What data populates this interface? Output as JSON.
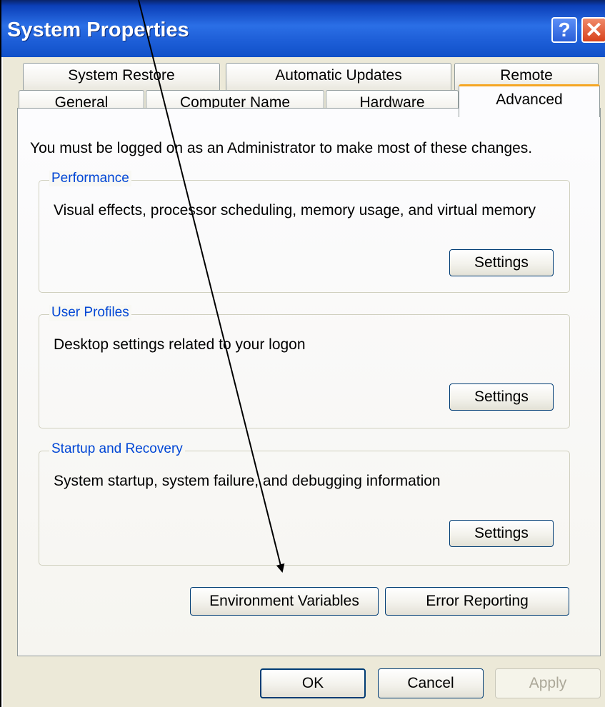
{
  "window": {
    "title": "System Properties",
    "help_glyph": "?",
    "close_glyph": "✕"
  },
  "tabs": {
    "row1": [
      "System Restore",
      "Automatic Updates",
      "Remote"
    ],
    "row2": [
      "General",
      "Computer Name",
      "Hardware",
      "Advanced"
    ],
    "active": "Advanced"
  },
  "advanced": {
    "info": "You must be logged on as an Administrator to make most of these changes.",
    "performance": {
      "title": "Performance",
      "description": "Visual effects, processor scheduling, memory usage, and virtual memory",
      "button": "Settings"
    },
    "user_profiles": {
      "title": "User Profiles",
      "description": "Desktop settings related to your logon",
      "button": "Settings"
    },
    "startup_recovery": {
      "title": "Startup and Recovery",
      "description": "System startup, system failure, and debugging information",
      "button": "Settings"
    },
    "environment_variables_button": "Environment Variables",
    "error_reporting_button": "Error Reporting"
  },
  "dialog_buttons": {
    "ok": "OK",
    "cancel": "Cancel",
    "apply": "Apply"
  },
  "colors": {
    "title_bar": "#2b6fe6",
    "group_title": "#0046d5",
    "active_tab_accent": "#f5a623"
  }
}
